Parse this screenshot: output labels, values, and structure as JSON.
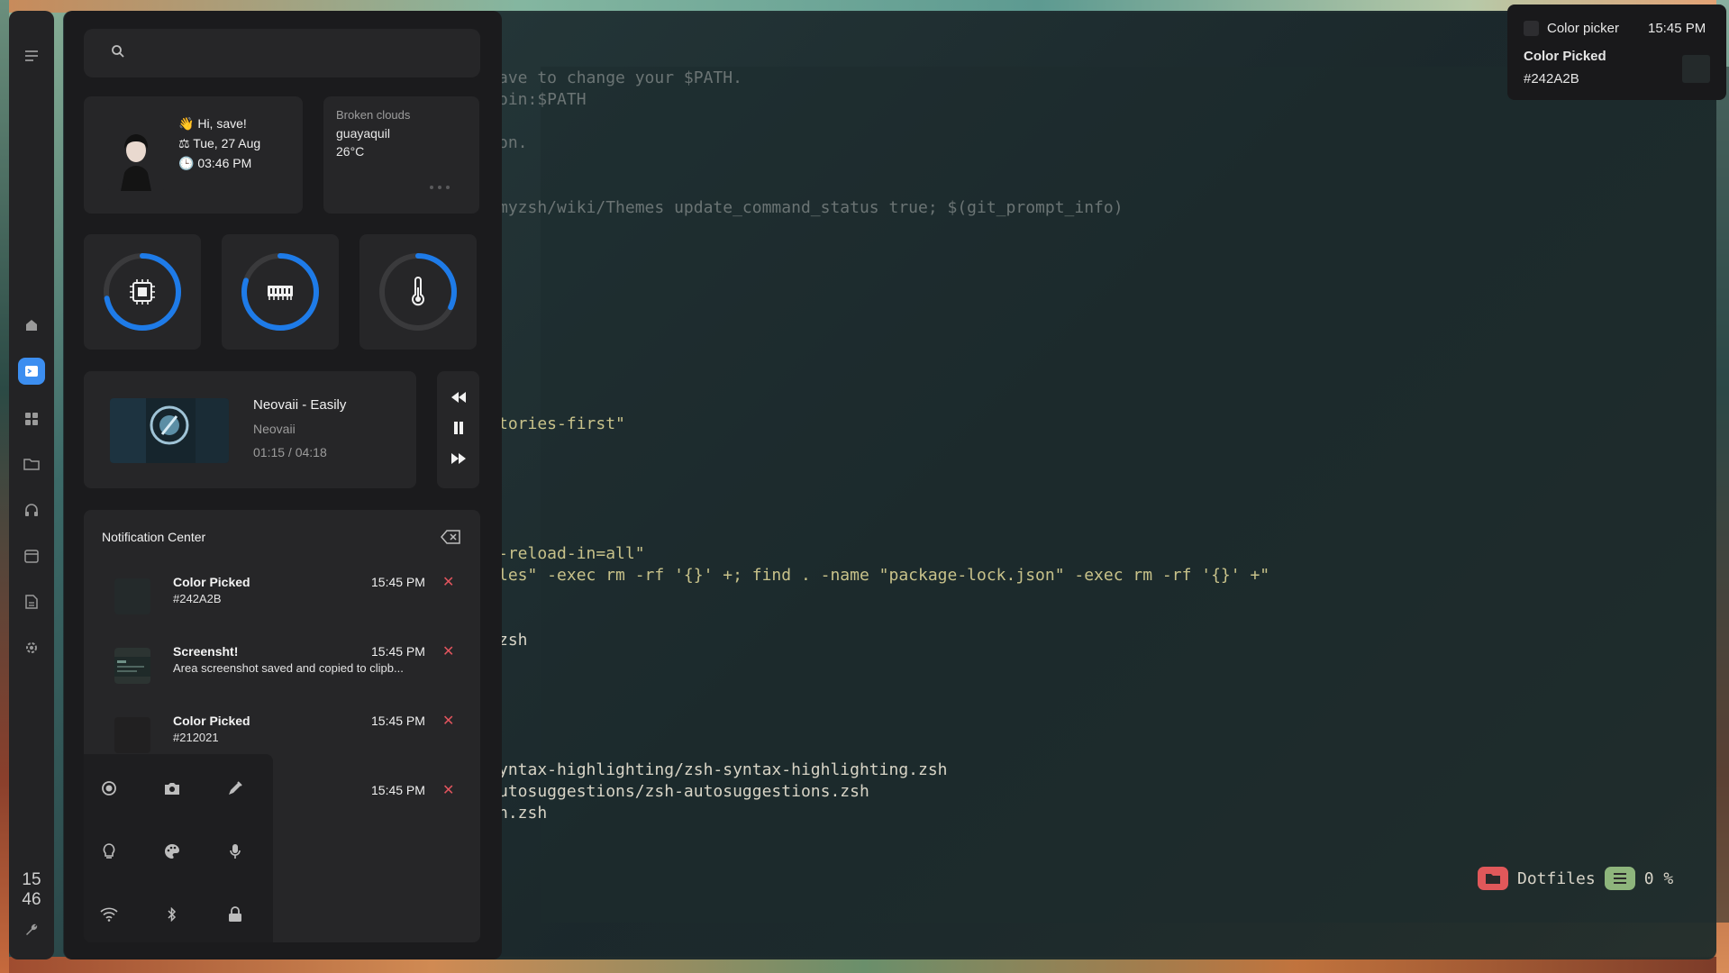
{
  "terminal": {
    "lines": [
      "ave to change your $PATH.",
      "oin:$PATH",
      "on.",
      "myzsh/wiki/Themes update_command_status true; $(git_prompt_info)",
      "tories-first\"",
      "-reload-in=all\"",
      "les\" -exec rm -rf '{}' +; find . -name \"package-lock.json\" -exec rm -rf '{}' +\"",
      "zsh",
      "yntax-highlighting/zsh-syntax-highlighting.zsh",
      "utosuggestions/zsh-autosuggestions.zsh",
      "n.zsh"
    ],
    "status_dir": "Dotfiles",
    "status_percent": "0 %"
  },
  "dock": {
    "clock_hour": "15",
    "clock_min": "46",
    "active_item": "terminal"
  },
  "search": {
    "placeholder": ""
  },
  "profile": {
    "greeting": "Hi, save!",
    "date": "Tue, 27 Aug",
    "time": "03:46 PM"
  },
  "weather": {
    "condition": "Broken clouds",
    "city": "guayaquil",
    "temp": "26°C"
  },
  "gauges": [
    {
      "name": "cpu",
      "icon": "cpu-icon",
      "level": 0.72,
      "color": "#1e7be8"
    },
    {
      "name": "ram",
      "icon": "ram-icon",
      "level": 0.8,
      "color": "#1e7be8"
    },
    {
      "name": "temperature",
      "icon": "thermometer-icon",
      "level": 0.32,
      "color": "#1e7be8"
    }
  ],
  "music": {
    "title": "Neovaii - Easily",
    "artist": "Neovaii",
    "progress": "01:15 / 04:18"
  },
  "notifications": {
    "title": "Notification Center",
    "items": [
      {
        "title": "Color Picked",
        "body": "#242A2B",
        "time": "15:45 PM",
        "thumb": "#242a2b"
      },
      {
        "title": "Screensht!",
        "body": "Area screenshot saved and copied to clipb...",
        "time": "15:45 PM",
        "thumb": "#2c3432"
      },
      {
        "title": "Color Picked",
        "body": "#212021",
        "time": "15:45 PM",
        "thumb": "#212021"
      },
      {
        "title": "",
        "body": "",
        "time": "15:45 PM",
        "thumb": "#262628"
      }
    ]
  },
  "toast": {
    "app": "Color picker",
    "time": "15:45 PM",
    "title": "Color Picked",
    "body": "#242A2B",
    "swatch": "#242A2B"
  },
  "colors": {
    "accent": "#3c8ef0",
    "close": "#e0545d"
  }
}
